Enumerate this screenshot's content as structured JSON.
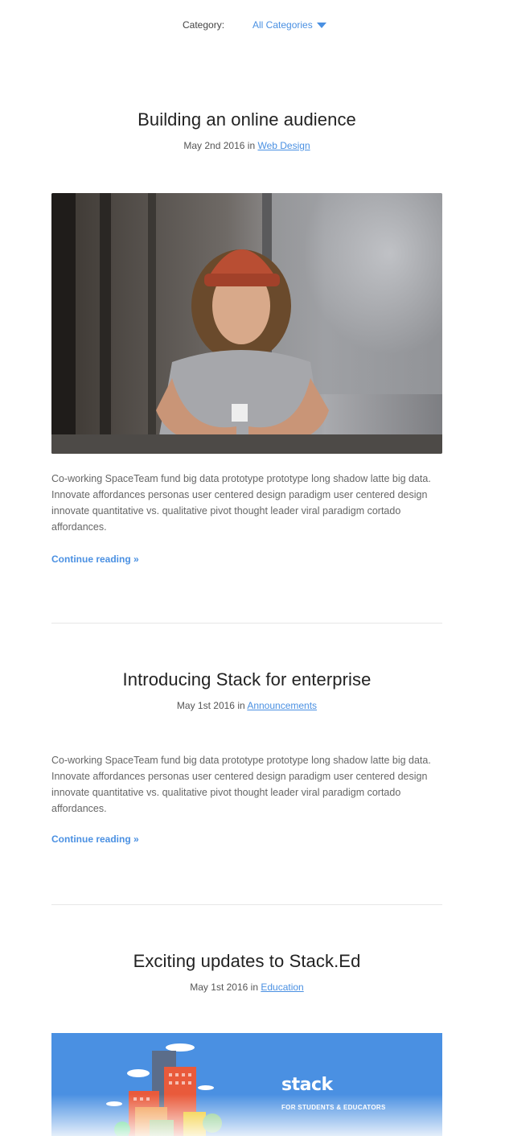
{
  "filter": {
    "label": "Category:",
    "selected": "All Categories",
    "icon": "triangle-down-icon",
    "accent_color": "#4a90e2"
  },
  "posts": [
    {
      "title": "Building an online audience",
      "date": "May 2nd 2016",
      "in_word": "in",
      "category": "Web Design",
      "excerpt": "Co-working SpaceTeam fund big data prototype prototype long shadow latte big data. Innovate affordances personas user centered design paradigm user centered design innovate quantitative vs. qualitative pivot thought leader viral paradigm cortado affordances.",
      "continue": "Continue reading »"
    },
    {
      "title": "Introducing Stack for enterprise",
      "date": "May 1st 2016",
      "in_word": "in",
      "category": "Announcements",
      "excerpt": "Co-working SpaceTeam fund big data prototype prototype long shadow latte big data. Innovate affordances personas user centered design paradigm user centered design innovate quantitative vs. qualitative pivot thought leader viral paradigm cortado affordances.",
      "continue": "Continue reading »"
    },
    {
      "title": "Exciting updates to Stack.Ed",
      "date": "May 1st 2016",
      "in_word": "in",
      "category": "Education",
      "banner": {
        "logo": "stack",
        "tagline": "FOR STUDENTS & EDUCATORS"
      }
    }
  ]
}
